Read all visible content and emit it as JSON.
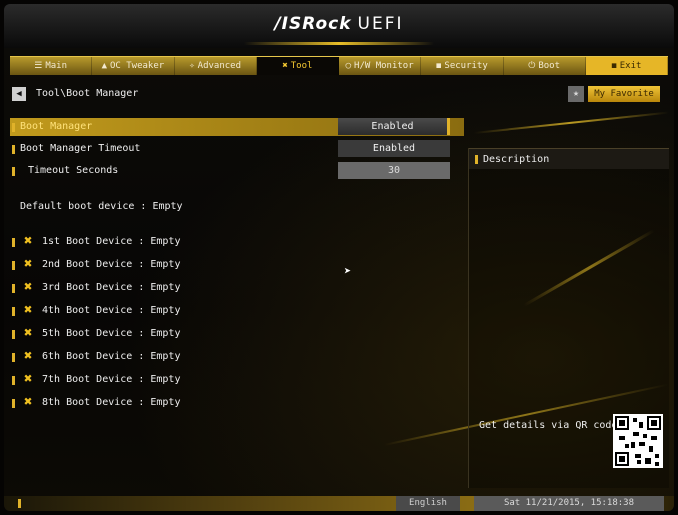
{
  "header": {
    "brand": "/ISRock",
    "product": "UEFI"
  },
  "tabs": [
    {
      "label": "Main",
      "icon": "list-icon"
    },
    {
      "label": "OC Tweaker",
      "icon": "tweaker-icon"
    },
    {
      "label": "Advanced",
      "icon": "advanced-icon"
    },
    {
      "label": "Tool",
      "icon": "tool-icon",
      "active": true
    },
    {
      "label": "H/W Monitor",
      "icon": "monitor-icon"
    },
    {
      "label": "Security",
      "icon": "shield-icon"
    },
    {
      "label": "Boot",
      "icon": "power-icon"
    },
    {
      "label": "Exit",
      "icon": "exit-icon"
    }
  ],
  "breadcrumb": "Tool\\Boot Manager",
  "favorite_label": "My Favorite",
  "settings": [
    {
      "label": "Boot Manager",
      "value": "Enabled"
    },
    {
      "label": "Boot Manager Timeout",
      "value": "Enabled"
    },
    {
      "label": "Timeout Seconds",
      "value": "30"
    }
  ],
  "default_boot": "Default boot device : Empty",
  "boot_devices": [
    "1st Boot Device : Empty",
    "2nd Boot Device : Empty",
    "3rd Boot Device : Empty",
    "4th Boot Device : Empty",
    "5th Boot Device : Empty",
    "6th Boot Device : Empty",
    "7th Boot Device : Empty",
    "8th Boot Device : Empty"
  ],
  "description": {
    "title": "Description",
    "qr_text": "Get details via QR code"
  },
  "footer": {
    "language": "English",
    "datetime": "Sat 11/21/2015, 15:18:38"
  },
  "colors": {
    "accent": "#e0b22a",
    "background": "#070605"
  }
}
